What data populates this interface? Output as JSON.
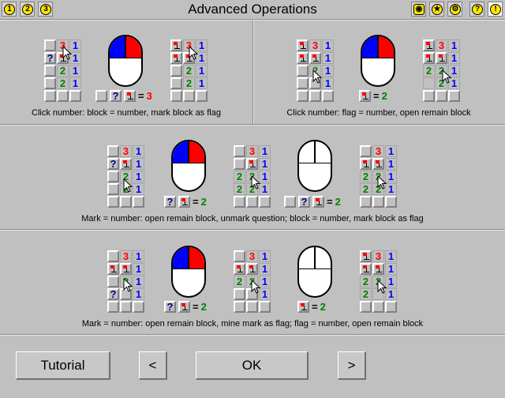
{
  "window": {
    "title": "Advanced Operations"
  },
  "toolbar_left": {
    "b1": "1",
    "b2": "2",
    "b3": "3"
  },
  "toolbar_right": {
    "help_label": "?",
    "alert_label": "!"
  },
  "sections": {
    "s1_left_caption": "Click number: block = number, mark block as flag",
    "s1_right_caption": "Click number: flag = number, open remain block",
    "s2_caption": "Mark = number: open remain block, unmark question; block = number, mark block as flag",
    "s3_caption": "Mark = number: open remain block, mine mark as flag; flag = number, open remain block"
  },
  "equations": {
    "e1": {
      "eq": "=",
      "num": "3"
    },
    "e2": {
      "eq": "=",
      "num": "2"
    },
    "e3": {
      "eq": "=",
      "num": "2"
    },
    "e4": {
      "eq": "=",
      "num": "2"
    },
    "e5": {
      "eq": "=",
      "num": "2"
    },
    "e6": {
      "eq": "=",
      "num": "2"
    }
  },
  "buttons": {
    "tutorial": "Tutorial",
    "prev": "<",
    "ok": "OK",
    "next": ">"
  }
}
